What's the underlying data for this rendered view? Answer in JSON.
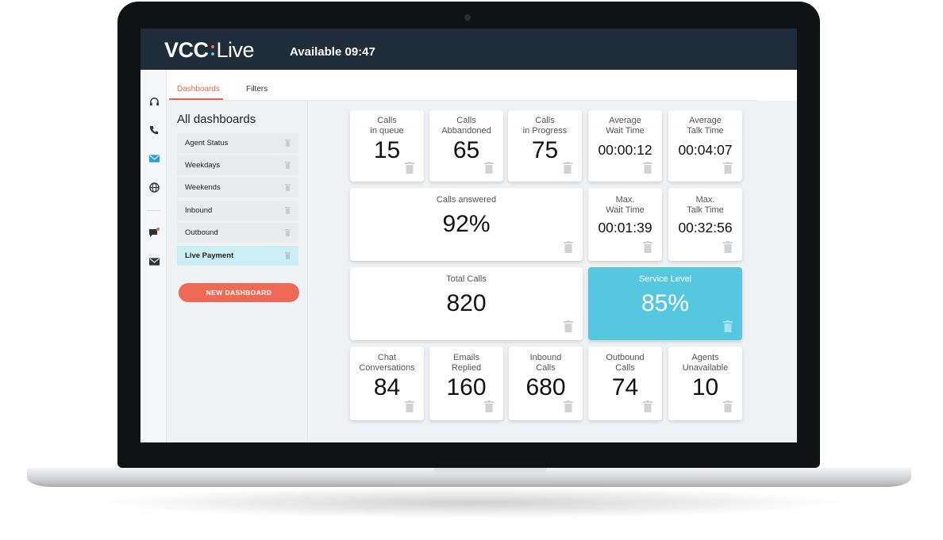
{
  "header": {
    "logo_left": "VCC",
    "logo_right": "Live",
    "status": "Available 09:47"
  },
  "rail_icons": [
    "headset-icon",
    "phone-icon",
    "email-icon",
    "globe-icon",
    "chat-icon",
    "mail-icon"
  ],
  "tabs": [
    {
      "label": "Dashboards",
      "active": true
    },
    {
      "label": "Filters",
      "active": false
    }
  ],
  "sidebar": {
    "title": "All dashboards",
    "items": [
      {
        "label": "Agent Status"
      },
      {
        "label": "Weekdays"
      },
      {
        "label": "Weekends"
      },
      {
        "label": "Inbound"
      },
      {
        "label": "Outbound"
      },
      {
        "label": "Live Payment",
        "active": true
      }
    ],
    "new_button": "NEW DASHBOARD"
  },
  "cards": [
    {
      "label": "Calls\nin queue",
      "value": "15"
    },
    {
      "label": "Calls\nAbbandoned",
      "value": "65"
    },
    {
      "label": "Calls\nin Progress",
      "value": "75"
    },
    {
      "label": "Average\nWait Time",
      "value": "00:00:12"
    },
    {
      "label": "Average\nTalk Time",
      "value": "00:04:07"
    },
    {
      "label": "Calls answered",
      "value": "92%"
    },
    {
      "label": "Max.\nWait Time",
      "value": "00:01:39"
    },
    {
      "label": "Max.\nTalk Time",
      "value": "00:32:56"
    },
    {
      "label": "Total Calls",
      "value": "820"
    },
    {
      "label": "Service Level",
      "value": "85%"
    },
    {
      "label": "Chat\nConversations",
      "value": "84"
    },
    {
      "label": "Emails\nReplied",
      "value": "160"
    },
    {
      "label": "Inbound\nCalls",
      "value": "680"
    },
    {
      "label": "Outbound\nCalls",
      "value": "74"
    },
    {
      "label": "Agents\nUnavailable",
      "value": "10"
    }
  ],
  "colors": {
    "header_bg": "#1f2d3a",
    "accent": "#e8604f",
    "highlight": "#55c8e0",
    "logo_dot_top": "#ef6a56",
    "logo_dot_bottom": "#55c8e0"
  }
}
